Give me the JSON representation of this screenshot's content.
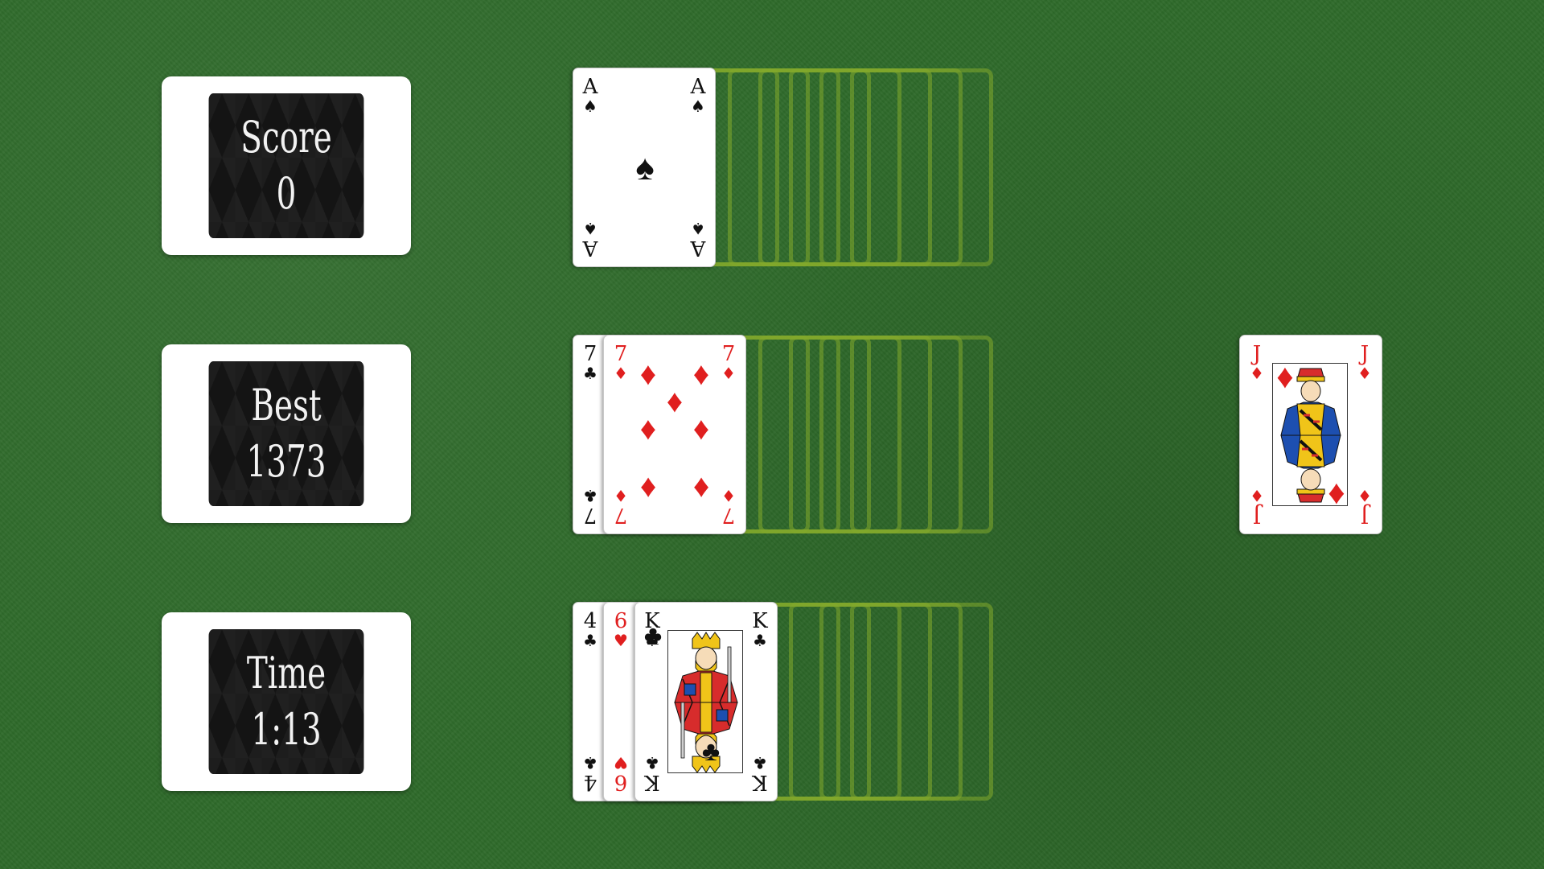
{
  "stats": {
    "score": {
      "label": "Score",
      "value": "0"
    },
    "best": {
      "label": "Best",
      "value": "1373"
    },
    "time": {
      "label": "Time",
      "value": "1:13"
    }
  },
  "rows": [
    {
      "cards": [
        {
          "rank": "A",
          "suit": "♠",
          "color": "black"
        }
      ]
    },
    {
      "cards": [
        {
          "rank": "7",
          "suit": "♣",
          "color": "black"
        },
        {
          "rank": "7",
          "suit": "♦",
          "color": "red"
        }
      ]
    },
    {
      "cards": [
        {
          "rank": "4",
          "suit": "♣",
          "color": "black"
        },
        {
          "rank": "6",
          "suit": "♥",
          "color": "red"
        },
        {
          "rank": "K",
          "suit": "♣",
          "color": "black"
        }
      ]
    }
  ],
  "current_card": {
    "rank": "J",
    "suit": "♦",
    "color": "red"
  },
  "colors": {
    "felt": "#2e6a2a",
    "slot_outline": "#84aa2c",
    "red_suit": "#e01f1f",
    "black_suit": "#111111",
    "panel_bg": "#141414"
  }
}
